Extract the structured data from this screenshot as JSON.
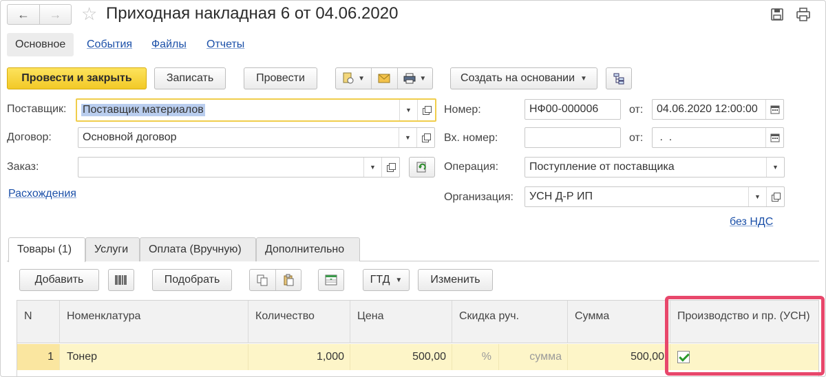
{
  "header": {
    "title": "Приходная накладная 6 от 04.06.2020"
  },
  "top_tabs": {
    "main": "Основное",
    "links": [
      "События",
      "Файлы",
      "Отчеты"
    ]
  },
  "toolbar": {
    "post_and_close": "Провести и закрыть",
    "save": "Записать",
    "post": "Провести",
    "create_based_on": "Создать на основании"
  },
  "form": {
    "supplier_label": "Поставщик:",
    "supplier_value": "Поставщик материалов",
    "contract_label": "Договор:",
    "contract_value": "Основной договор",
    "order_label": "Заказ:",
    "order_value": "",
    "discrepancies_link": "Расхождения",
    "number_label": "Номер:",
    "number_value": "НФ00-000006",
    "from_label": "от:",
    "date_value": "04.06.2020 12:00:00",
    "in_number_label": "Вх. номер:",
    "in_number_value": "",
    "from2_label": "от:",
    "in_date_value": " .  .",
    "operation_label": "Операция:",
    "operation_value": "Поступление от поставщика",
    "organization_label": "Организация:",
    "organization_value": "УСН Д-Р ИП",
    "vat_link": "без НДС"
  },
  "lower_tabs": [
    "Товары (1)",
    "Услуги",
    "Оплата (Вручную)",
    "Дополнительно"
  ],
  "table_toolbar": {
    "add": "Добавить",
    "pick": "Подобрать",
    "gtd": "ГТД",
    "change": "Изменить"
  },
  "table": {
    "columns": [
      "N",
      "Номенклатура",
      "Количество",
      "Цена",
      "Скидка руч.",
      "Сумма",
      "Производство и пр. (УСН)"
    ],
    "rows": [
      {
        "n": "1",
        "item": "Тонер",
        "qty": "1,000",
        "price": "500,00",
        "discount_pct": "%",
        "discount_sum": "сумма",
        "sum": "500,00",
        "production": true
      }
    ]
  },
  "colors": {
    "primary_button": "#f2c927",
    "link": "#1a4fa8",
    "highlight_border": "#e8476b",
    "selected_row": "#fdf5c8"
  },
  "icons": [
    "arrow-left-icon",
    "arrow-right-icon",
    "star-icon",
    "save-icon",
    "print-icon",
    "document-icon",
    "envelope-icon",
    "structure-icon",
    "barcode-icon",
    "copy-icon",
    "paste-icon",
    "table-settings-icon",
    "calendar-icon",
    "refresh-icon"
  ]
}
